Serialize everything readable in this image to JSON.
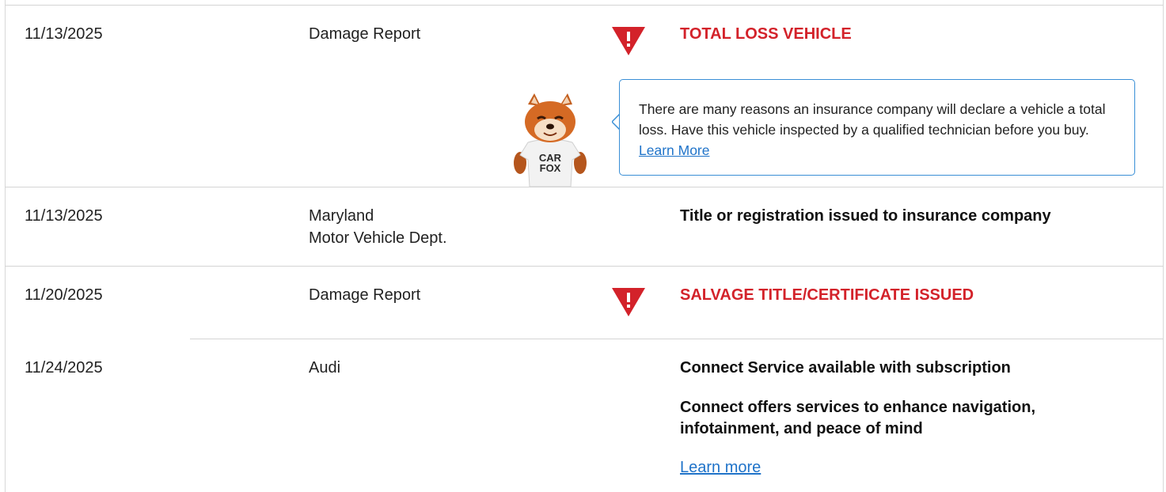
{
  "rows": [
    {
      "date": "11/13/2025",
      "source": "Damage Report",
      "alert": "TOTAL LOSS VEHICLE",
      "tooltip": {
        "text": "There are many reasons an insurance company will declare a vehicle a total loss. Have this vehicle inspected by a qualified technician before you buy.",
        "link_label": "Learn More"
      }
    },
    {
      "date": "11/13/2025",
      "source_line1": "Maryland",
      "source_line2": "Motor Vehicle Dept.",
      "comment": "Title or registration issued to insurance company"
    },
    {
      "date": "11/20/2025",
      "source": "Damage Report",
      "alert": "SALVAGE TITLE/CERTIFICATE ISSUED"
    },
    {
      "date": "11/24/2025",
      "source": "Audi",
      "comment1": "Connect Service available with subscription",
      "comment2_line1": "Connect offers services to enhance navigation,",
      "comment2_line2": "infotainment, and peace of mind",
      "link_label": "Learn more"
    }
  ],
  "mascot": {
    "shirt_line1": "CAR",
    "shirt_line2": "FOX"
  },
  "colors": {
    "alert_red": "#d3222a",
    "link_blue": "#1f73c9",
    "bubble_border": "#3a8fd6"
  },
  "icons": {
    "alert": "warning-triangle-icon"
  }
}
